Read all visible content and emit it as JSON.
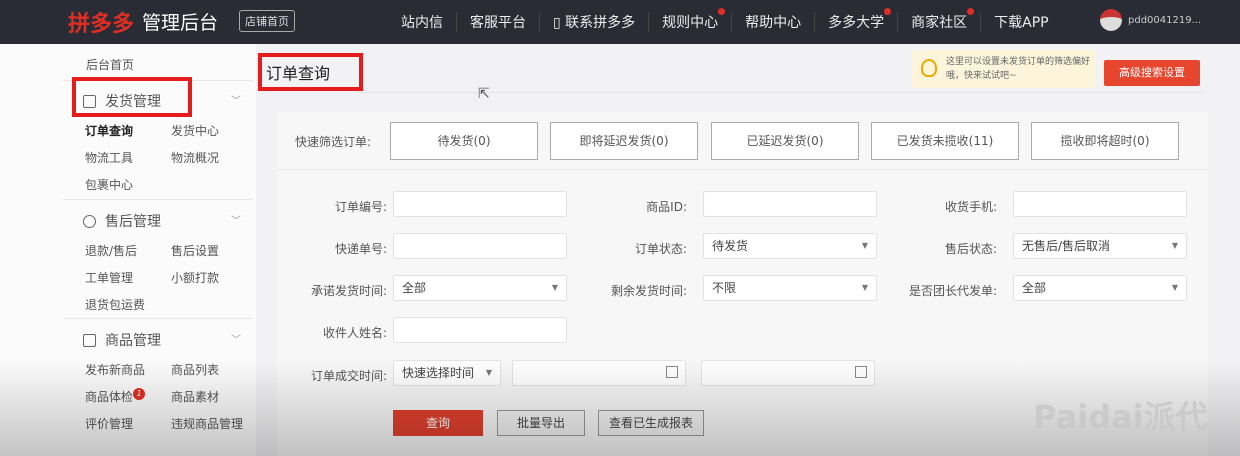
{
  "header": {
    "logo": "拼多多",
    "title": "管理后台",
    "tag": "店铺首页",
    "nav": [
      "站内信",
      "客服平台",
      "联系拼多多",
      "规则中心",
      "帮助中心",
      "多多大学",
      "商家社区",
      "下载APP"
    ],
    "user": "pdd0041219..."
  },
  "sidebar": {
    "home": "后台首页",
    "groups": [
      {
        "title": "发货管理",
        "items": [
          "订单查询",
          "发货中心",
          "物流工具",
          "物流概况",
          "包裹中心"
        ]
      },
      {
        "title": "售后管理",
        "items": [
          "退款/售后",
          "售后设置",
          "工单管理",
          "小额打款",
          "退货包运费"
        ]
      },
      {
        "title": "商品管理",
        "items": [
          "发布新商品",
          "商品列表",
          "商品体检",
          "商品素材",
          "评价管理",
          "违规商品管理"
        ],
        "badge": "1"
      }
    ]
  },
  "main": {
    "title": "订单查询",
    "tip": "这里可以设置未发货订单的筛选偏好哦，快来试试吧~",
    "adv_button": "高级搜索设置",
    "quick_label": "快速筛选订单:",
    "quick": [
      "待发货(0)",
      "即将延迟发货(0)",
      "已延迟发货(0)",
      "已发货未揽收(11)",
      "揽收即将超时(0)"
    ],
    "fields": {
      "order_no": "订单编号:",
      "goods_id": "商品ID:",
      "phone": "收货手机:",
      "express_no": "快递单号:",
      "order_status": "订单状态:",
      "order_status_val": "待发货",
      "after_status": "售后状态:",
      "after_status_val": "无售后/售后取消",
      "promise_time": "承诺发货时间:",
      "promise_time_val": "全部",
      "remain_time": "剩余发货时间:",
      "remain_time_val": "不限",
      "special": "是否团长代发单:",
      "special_val": "全部",
      "receiver": "收件人姓名:",
      "deal_time": "订单成交时间:",
      "deal_time_val": "快速选择时间"
    },
    "buttons": {
      "search": "查询",
      "export": "批量导出",
      "reports": "查看已生成报表"
    }
  },
  "watermark": "Paidai派代"
}
